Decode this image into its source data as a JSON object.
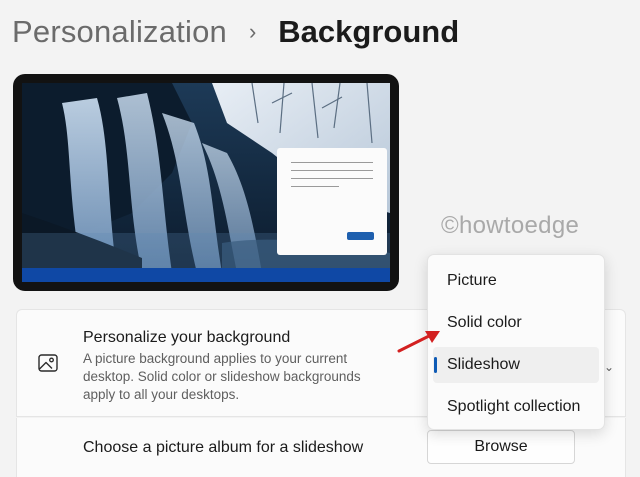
{
  "breadcrumb": {
    "parent": "Personalization",
    "separator": "›",
    "current": "Background"
  },
  "watermark": "©howtoedge",
  "background_card": {
    "title": "Personalize your background",
    "description": "A picture background applies to your current desktop. Solid color or slideshow backgrounds apply to all your desktops.",
    "icon": "image-icon"
  },
  "dropdown": {
    "options": [
      "Picture",
      "Solid color",
      "Slideshow",
      "Spotlight collection"
    ],
    "selected": "Slideshow"
  },
  "album_card": {
    "title": "Choose a picture album for a slideshow",
    "button": "Browse"
  },
  "colors": {
    "accent": "#0f5bb5",
    "annotation_arrow": "#d32020",
    "taskbar": "#0f48a5"
  }
}
